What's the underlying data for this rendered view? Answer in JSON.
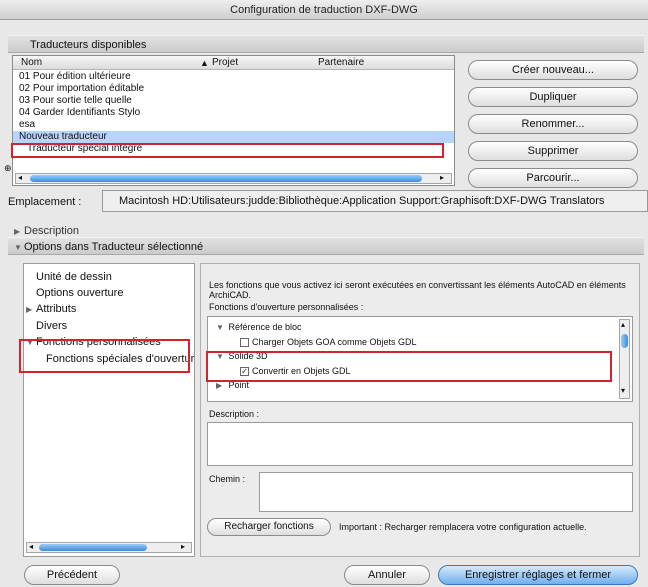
{
  "window": {
    "title": "Configuration de traduction DXF-DWG"
  },
  "translators": {
    "section_label": "Traducteurs disponibles",
    "col_name": "Nom",
    "col_project": "Projet",
    "col_partner": "Partenaire",
    "sort_glyph": "▲",
    "items": [
      "01 Pour édition ultérieure",
      "02 Pour importation éditable",
      "03 Pour sortie telle quelle",
      "04 Garder Identifiants Stylo",
      "esa",
      "Nouveau traducteur",
      "Traducteur spécial intégré"
    ],
    "selected_index": 5
  },
  "buttons": {
    "create_new": "Créer nouveau...",
    "duplicate": "Dupliquer",
    "rename": "Renommer...",
    "delete": "Supprimer",
    "browse": "Parcourir...",
    "reload": "Recharger fonctions",
    "previous": "Précédent",
    "cancel": "Annuler",
    "save_close": "Enregistrer réglages et fermer"
  },
  "location": {
    "label": "Emplacement :",
    "path": "Macintosh HD:Utilisateurs:judde:Bibliothèque:Application Support:Graphisoft:DXF-DWG Translators"
  },
  "description_section": {
    "label": "Description"
  },
  "options_section": {
    "label": "Options dans Traducteur sélectionné"
  },
  "tree": {
    "items": [
      {
        "label": "Unité de dessin"
      },
      {
        "label": "Options ouverture"
      },
      {
        "label": "Attributs"
      },
      {
        "label": "Divers"
      },
      {
        "label": "Fonctions personnalisées"
      },
      {
        "label": "Fonctions spéciales d'ouverture"
      }
    ]
  },
  "right_panel": {
    "intro": "Les fonctions que vous activez ici seront exécutées en convertissant les éléments AutoCAD en éléments ArchiCAD.",
    "functions_label": "Fonctions d'ouverture personnalisées :",
    "func_items": [
      {
        "label": "Référence de bloc",
        "type": "group"
      },
      {
        "label": "Charger Objets GOA comme Objets GDL",
        "type": "check",
        "checked": false
      },
      {
        "label": "Solide 3D",
        "type": "group"
      },
      {
        "label": "Convertir en Objets GDL",
        "type": "check",
        "checked": true
      },
      {
        "label": "Point",
        "type": "group"
      }
    ],
    "description_label": "Description :",
    "path_label": "Chemin :",
    "important_note": "Important : Recharger remplacera votre configuration actuelle."
  },
  "colors": {
    "accent": "#3c8ddb",
    "highlight": "#d2242c",
    "selection": "#b5d5fb"
  }
}
